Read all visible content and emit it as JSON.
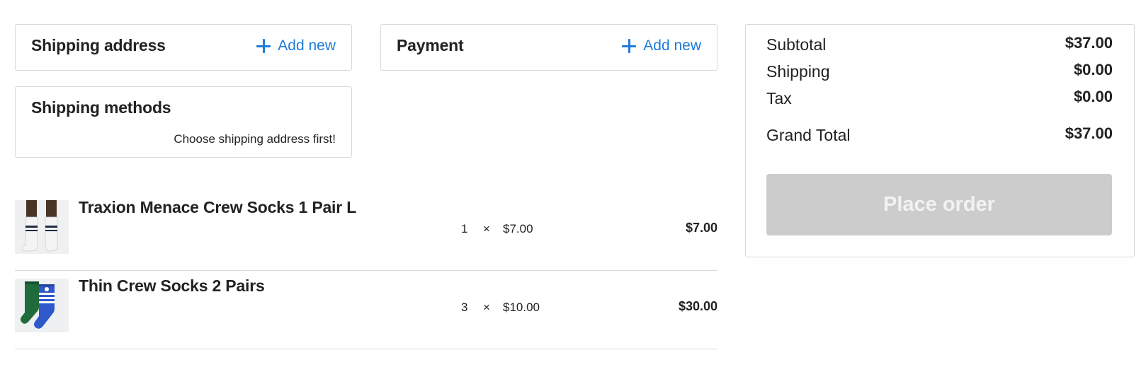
{
  "shipping_address": {
    "title": "Shipping address",
    "add_label": "Add new"
  },
  "payment": {
    "title": "Payment",
    "add_label": "Add new"
  },
  "shipping_methods": {
    "title": "Shipping methods",
    "note": "Choose shipping address first!"
  },
  "items": [
    {
      "name": "Traxion Menace Crew Socks 1 Pair L",
      "qty": "1",
      "times": "×",
      "price": "$7.00",
      "total": "$7.00",
      "image": "white-crew-socks"
    },
    {
      "name": "Thin Crew Socks 2 Pairs",
      "qty": "3",
      "times": "×",
      "price": "$10.00",
      "total": "$30.00",
      "image": "green-blue-crew-socks"
    }
  ],
  "summary": {
    "subtotal_label": "Subtotal",
    "subtotal_value": "$37.00",
    "shipping_label": "Shipping",
    "shipping_value": "$0.00",
    "tax_label": "Tax",
    "tax_value": "$0.00",
    "grand_total_label": "Grand Total",
    "grand_total_value": "$37.00",
    "place_order_label": "Place order"
  },
  "colors": {
    "accent": "#1d7bd8",
    "border": "#d9d9d9",
    "disabled_button": "#cccccc",
    "text": "#222222"
  }
}
